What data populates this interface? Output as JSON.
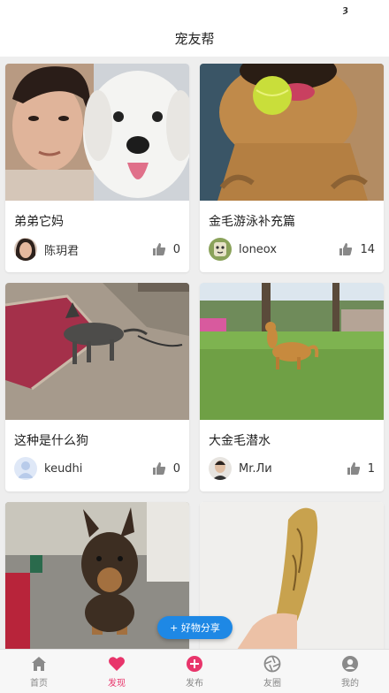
{
  "status_bar": {
    "glyph": "ȝ"
  },
  "header": {
    "title": "宠友帮"
  },
  "feed": {
    "cards": [
      {
        "title": "弟弟它妈",
        "author": "陈玥君",
        "likes": "0"
      },
      {
        "title": "金毛游泳补充篇",
        "author": "loneox",
        "likes": "14"
      },
      {
        "title": "这种是什么狗",
        "author": "keudhi",
        "likes": "0"
      },
      {
        "title": "大金毛潜水",
        "author": "Mr.Ли",
        "likes": "1"
      }
    ]
  },
  "share_button": {
    "label": "+ 好物分享"
  },
  "tabs": [
    {
      "label": "首页",
      "icon": "home-icon"
    },
    {
      "label": "发现",
      "icon": "heart-icon"
    },
    {
      "label": "发布",
      "icon": "plus-circle-icon"
    },
    {
      "label": "友圈",
      "icon": "aperture-icon"
    },
    {
      "label": "我的",
      "icon": "user-icon"
    }
  ],
  "colors": {
    "accent": "#e8356b",
    "fab": "#1e88e5",
    "background": "#eeeeee"
  }
}
